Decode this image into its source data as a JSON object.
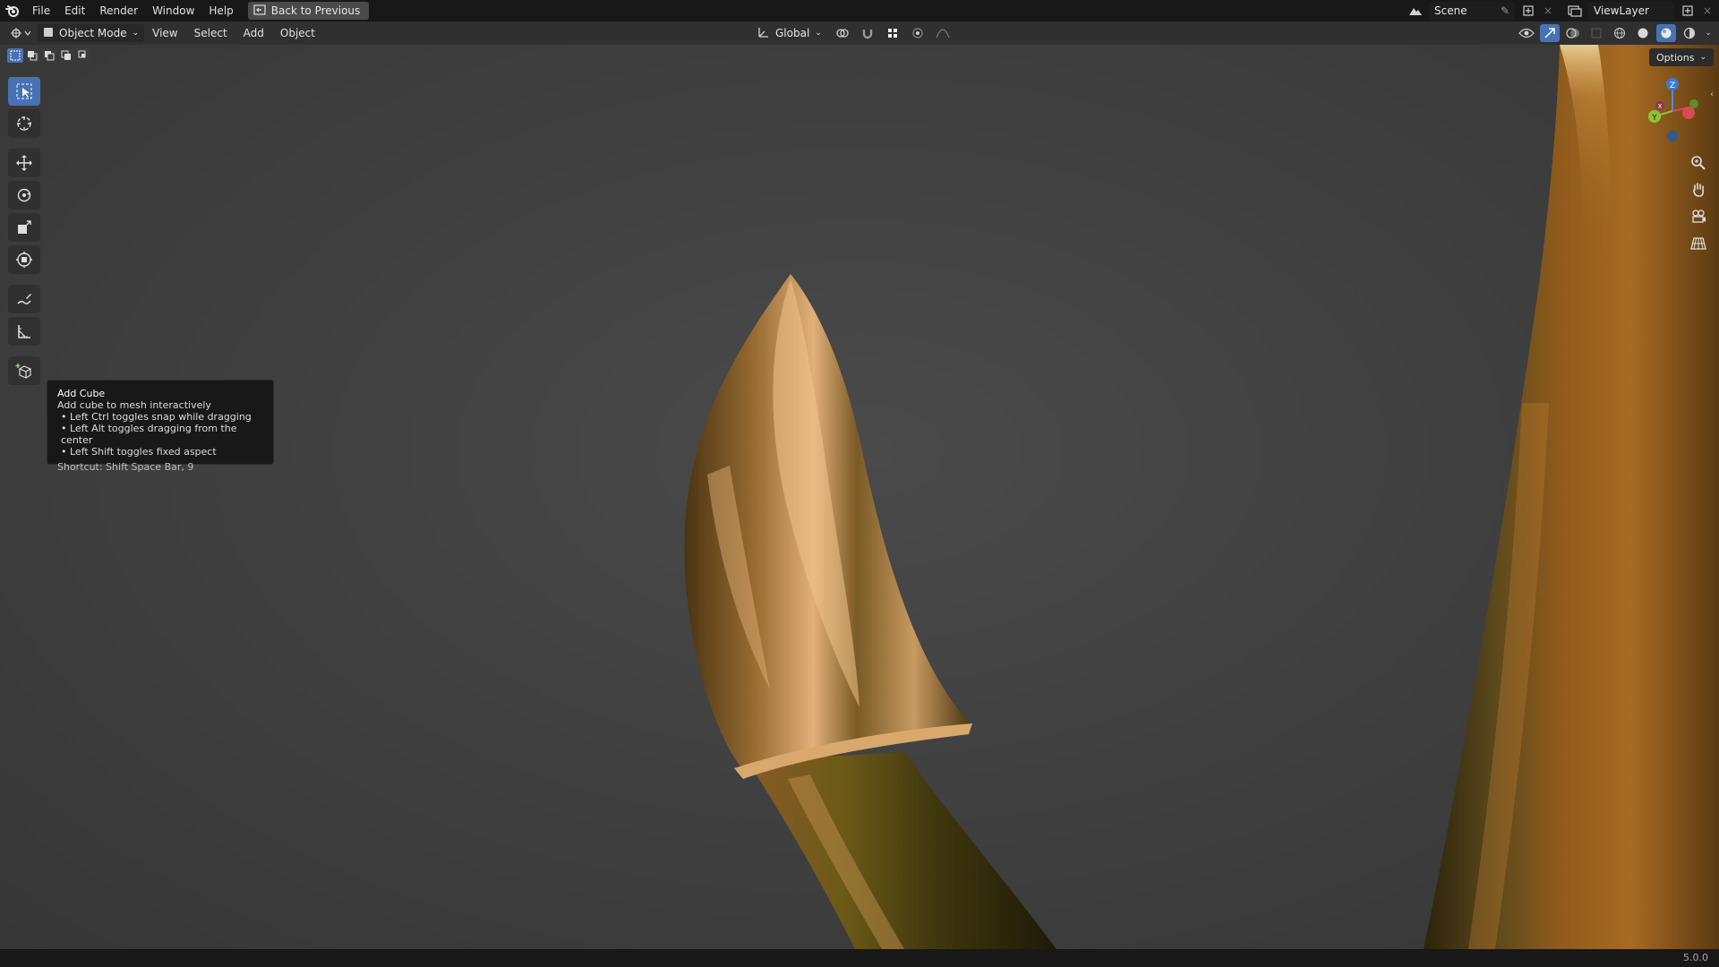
{
  "topbar": {
    "menus": [
      "File",
      "Edit",
      "Render",
      "Window",
      "Help"
    ],
    "back_button": "Back to Previous",
    "scene": "Scene",
    "view_layer": "ViewLayer"
  },
  "header": {
    "mode": "Object Mode",
    "menus": [
      "View",
      "Select",
      "Add",
      "Object"
    ],
    "transform_orientation": "Global"
  },
  "viewport": {
    "options_label": "Options",
    "gizmo_axes": [
      "Z",
      "Y",
      "X"
    ]
  },
  "tooltip": {
    "title": "Add Cube",
    "description": "Add cube to mesh interactively",
    "bullets": [
      "• Left Ctrl toggles snap while dragging",
      "• Left Alt toggles dragging from the center",
      "• Left Shift toggles fixed aspect"
    ],
    "shortcut": "Shortcut: Shift Space Bar, 9"
  },
  "status": {
    "version": "5.0.0"
  },
  "colors": {
    "accent": "#4772b3",
    "gold_light": "#e6b37a",
    "gold_dark": "#3b2a10"
  }
}
